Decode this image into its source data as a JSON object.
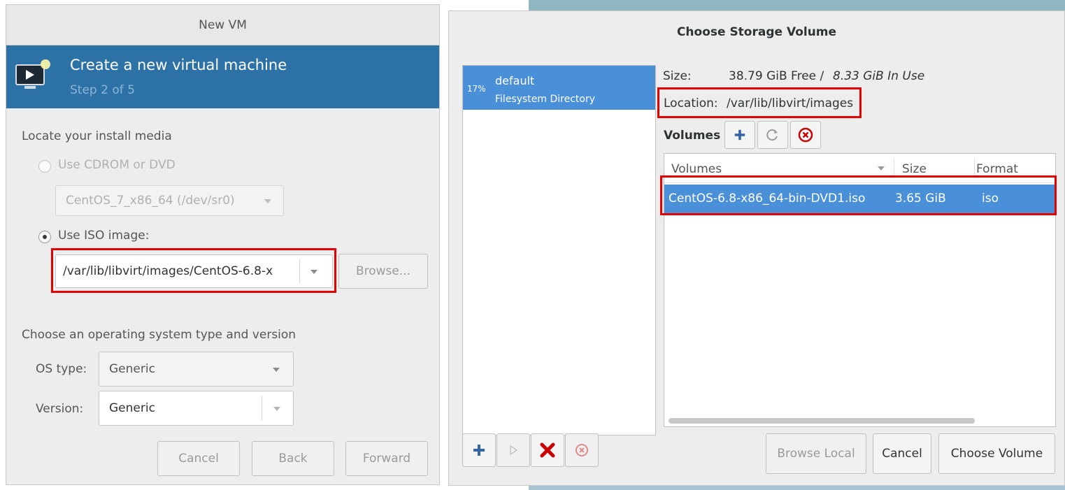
{
  "new_vm": {
    "window_title": "New VM",
    "banner_title": "Create a new virtual machine",
    "banner_step": "Step 2 of 5",
    "locate_label": "Locate your install media",
    "cdrom_label": "Use CDROM or DVD",
    "cdrom_device": "CentOS_7_x86_64 (/dev/sr0)",
    "iso_label": "Use ISO image:",
    "iso_path": "/var/lib/libvirt/images/CentOS-6.8-x",
    "browse_label": "Browse...",
    "os_section_label": "Choose an operating system type and version",
    "os_type_label": "OS type:",
    "os_type_value": "Generic",
    "version_label": "Version:",
    "version_value": "Generic",
    "cancel_label": "Cancel",
    "back_label": "Back",
    "forward_label": "Forward"
  },
  "storage": {
    "window_title": "Choose Storage Volume",
    "pool": {
      "percent": "17%",
      "name": "default",
      "type": "Filesystem Directory"
    },
    "size_label": "Size:",
    "size_free": "38.79 GiB Free /",
    "size_in_use": "8.33 GiB In Use",
    "location_label": "Location:",
    "location_value": "/var/lib/libvirt/images",
    "volumes_label": "Volumes",
    "columns": [
      "Volumes",
      "Size",
      "Format"
    ],
    "rows": [
      {
        "name": "CentOS-6.8-x86_64-bin-DVD1.iso",
        "size": "3.65 GiB",
        "format": "iso"
      }
    ],
    "browse_local_label": "Browse Local",
    "cancel_label": "Cancel",
    "choose_label": "Choose Volume"
  },
  "colors": {
    "banner": "#2d72a6",
    "selection": "#4a90d9",
    "highlight_box": "#e60000"
  }
}
